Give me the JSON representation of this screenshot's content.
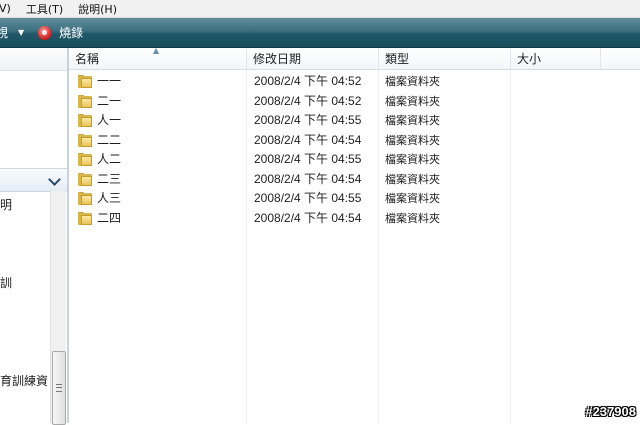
{
  "menu": [
    "V)",
    "工具(T)",
    "說明(H)"
  ],
  "toolbar": {
    "view_label": "視",
    "burn_label": "燒錄"
  },
  "left_pane": {
    "tree_items": [
      "明",
      "訓",
      "育訓練資"
    ]
  },
  "columns": {
    "name": "名稱",
    "modified": "修改日期",
    "type": "類型",
    "size": "大小"
  },
  "files": [
    {
      "name": "一一",
      "modified": "2008/2/4 下午 04:52",
      "type": "檔案資料夾"
    },
    {
      "name": "二一",
      "modified": "2008/2/4 下午 04:52",
      "type": "檔案資料夾"
    },
    {
      "name": "人一",
      "modified": "2008/2/4 下午 04:55",
      "type": "檔案資料夾"
    },
    {
      "name": "二二",
      "modified": "2008/2/4 下午 04:54",
      "type": "檔案資料夾"
    },
    {
      "name": "人二",
      "modified": "2008/2/4 下午 04:55",
      "type": "檔案資料夾"
    },
    {
      "name": "二三",
      "modified": "2008/2/4 下午 04:54",
      "type": "檔案資料夾"
    },
    {
      "name": "人三",
      "modified": "2008/2/4 下午 04:55",
      "type": "檔案資料夾"
    },
    {
      "name": "二四",
      "modified": "2008/2/4 下午 04:54",
      "type": "檔案資料夾"
    }
  ],
  "watermark": "#237908"
}
